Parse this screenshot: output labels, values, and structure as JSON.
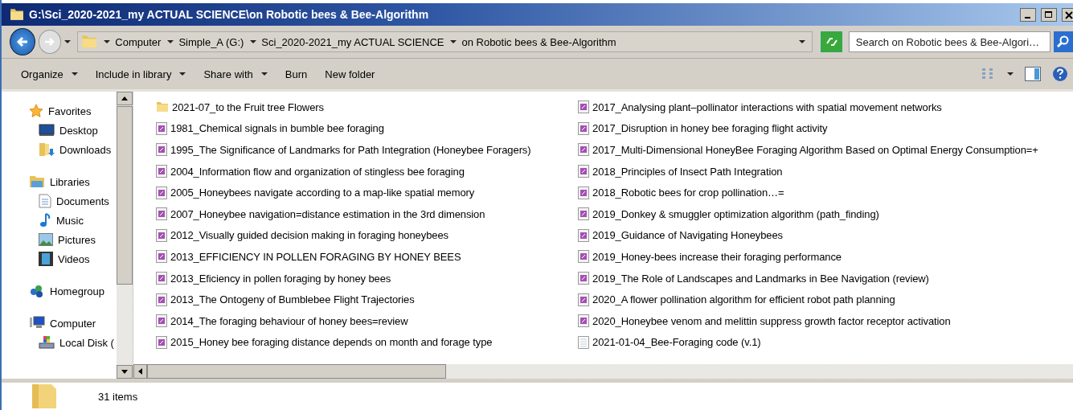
{
  "window": {
    "title": "G:\\Sci_2020-2021_my ACTUAL SCIENCE\\on Robotic bees & Bee-Algorithm"
  },
  "address_bar": {
    "breadcrumbs": [
      "Computer",
      "Simple_A (G:)",
      "Sci_2020-2021_my ACTUAL SCIENCE",
      "on Robotic bees & Bee-Algorithm"
    ]
  },
  "search": {
    "placeholder": "Search on Robotic bees & Bee-Algori…"
  },
  "toolbar": {
    "buttons": [
      {
        "label": "Organize",
        "dropdown": true
      },
      {
        "label": "Include in library",
        "dropdown": true
      },
      {
        "label": "Share with",
        "dropdown": true
      },
      {
        "label": "Burn",
        "dropdown": false
      },
      {
        "label": "New folder",
        "dropdown": false
      }
    ]
  },
  "navigation_pane": {
    "items": [
      {
        "label": "Favorites",
        "kind": "star",
        "children": [
          {
            "label": "Desktop",
            "kind": "desktop"
          },
          {
            "label": "Downloads",
            "kind": "downloads"
          }
        ]
      },
      {
        "label": "Libraries",
        "kind": "library",
        "children": [
          {
            "label": "Documents",
            "kind": "document"
          },
          {
            "label": "Music",
            "kind": "music"
          },
          {
            "label": "Pictures",
            "kind": "picture"
          },
          {
            "label": "Videos",
            "kind": "video"
          }
        ]
      },
      {
        "label": "Homegroup",
        "kind": "homegroup"
      },
      {
        "label": "Computer",
        "kind": "computer",
        "children": [
          {
            "label": "Local Disk (",
            "kind": "disk"
          }
        ]
      }
    ]
  },
  "files": [
    {
      "name": "2021-07_to the Fruit tree Flowers",
      "kind": "folder"
    },
    {
      "name": "1981_Chemical signals in bumble bee foraging",
      "kind": "pdf"
    },
    {
      "name": "1995_The Significance of Landmarks for Path Integration (Honeybee Foragers)",
      "kind": "pdf"
    },
    {
      "name": "2004_Information flow and organization of stingless bee foraging",
      "kind": "pdf"
    },
    {
      "name": "2005_Honeybees navigate according to a map-like spatial memory",
      "kind": "pdf"
    },
    {
      "name": "2007_Honeybee navigation=distance estimation in the 3rd dimension",
      "kind": "pdf"
    },
    {
      "name": "2012_Visually guided decision making in foraging honeybees",
      "kind": "pdf"
    },
    {
      "name": "2013_EFFICIENCY IN POLLEN FORAGING BY HONEY BEES",
      "kind": "pdf"
    },
    {
      "name": "2013_Eficiency in pollen foraging by honey bees",
      "kind": "pdf"
    },
    {
      "name": "2013_The Ontogeny of Bumblebee Flight Trajectories",
      "kind": "pdf"
    },
    {
      "name": "2014_The foraging behaviour of honey bees=review",
      "kind": "pdf"
    },
    {
      "name": "2015_Honey bee foraging distance depends on month and forage type",
      "kind": "pdf"
    },
    {
      "name": "2017_Analysing plant–pollinator interactions with spatial movement networks",
      "kind": "pdf"
    },
    {
      "name": "2017_Disruption in honey bee foraging flight activity",
      "kind": "pdf"
    },
    {
      "name": "2017_Multi-Dimensional HoneyBee Foraging Algorithm Based on Optimal Energy Consumption=+",
      "kind": "pdf"
    },
    {
      "name": "2018_Principles of Insect Path Integration",
      "kind": "pdf"
    },
    {
      "name": "2018_Robotic bees for crop pollination…=",
      "kind": "pdf"
    },
    {
      "name": "2019_Donkey & smuggler optimization algorithm (path_finding)",
      "kind": "pdf"
    },
    {
      "name": "2019_Guidance of Navigating Honeybees",
      "kind": "pdf"
    },
    {
      "name": "2019_Honey-bees increase their foraging performance",
      "kind": "pdf"
    },
    {
      "name": "2019_The Role of Landscapes and Landmarks in Bee Navigation (review)",
      "kind": "pdf"
    },
    {
      "name": "2020_A flower pollination algorithm for efficient robot path planning",
      "kind": "pdf"
    },
    {
      "name": "2020_Honeybee venom and melittin suppress growth factor receptor activation",
      "kind": "pdf"
    },
    {
      "name": "2021-01-04_Bee-Foraging code (v.1)",
      "kind": "text"
    }
  ],
  "status_bar": {
    "item_count": "31 items"
  }
}
